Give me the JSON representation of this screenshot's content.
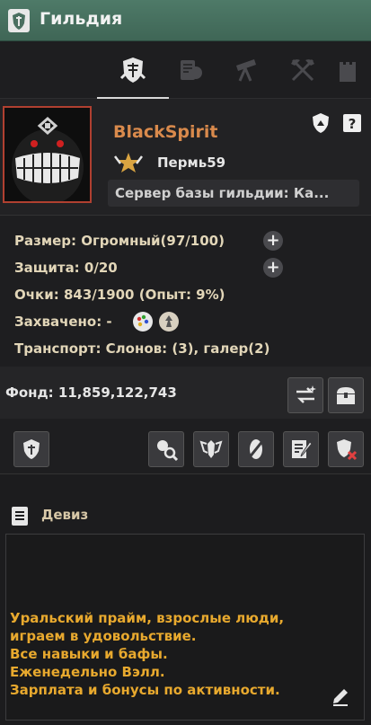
{
  "window": {
    "title": "Гильдия",
    "title_icon": "guild-shield-icon"
  },
  "tabs": [
    {
      "icon": "guild-crest-icon",
      "active": true
    },
    {
      "icon": "member-scroll-icon",
      "active": false
    },
    {
      "icon": "telescope-icon",
      "active": false
    },
    {
      "icon": "crossed-axes-icon",
      "active": false
    },
    {
      "icon": "castle-tower-icon",
      "active": false
    }
  ],
  "profile": {
    "guild_name": "BlackSpirit",
    "rank": "Пермь59",
    "server": "Сервер базы гильдии: Ка..."
  },
  "stats": {
    "size": "Размер: Огромный(97/100)",
    "protection": "Защита: 0/20",
    "points": "Очки: 843/1900 (Опыт: 9%)",
    "captured": "Захвачено: -",
    "transport": "Транспорт: Слонов: (3), галер(2)"
  },
  "fund": {
    "label": "Фонд: 11,859,122,743"
  },
  "motto": {
    "heading": "Девиз",
    "lines": [
      "Уральский прайм, взрослые люди,",
      "играем в удовольствие.",
      "Все навыки и бафы.",
      "Еженедельно Вэлл.",
      "Зарплата и бонусы по активности."
    ]
  },
  "colors": {
    "title_bar": "#46705f",
    "guild_name": "#d98a4c",
    "motto_text": "#e8a92e",
    "emblem_border": "#b04030"
  }
}
